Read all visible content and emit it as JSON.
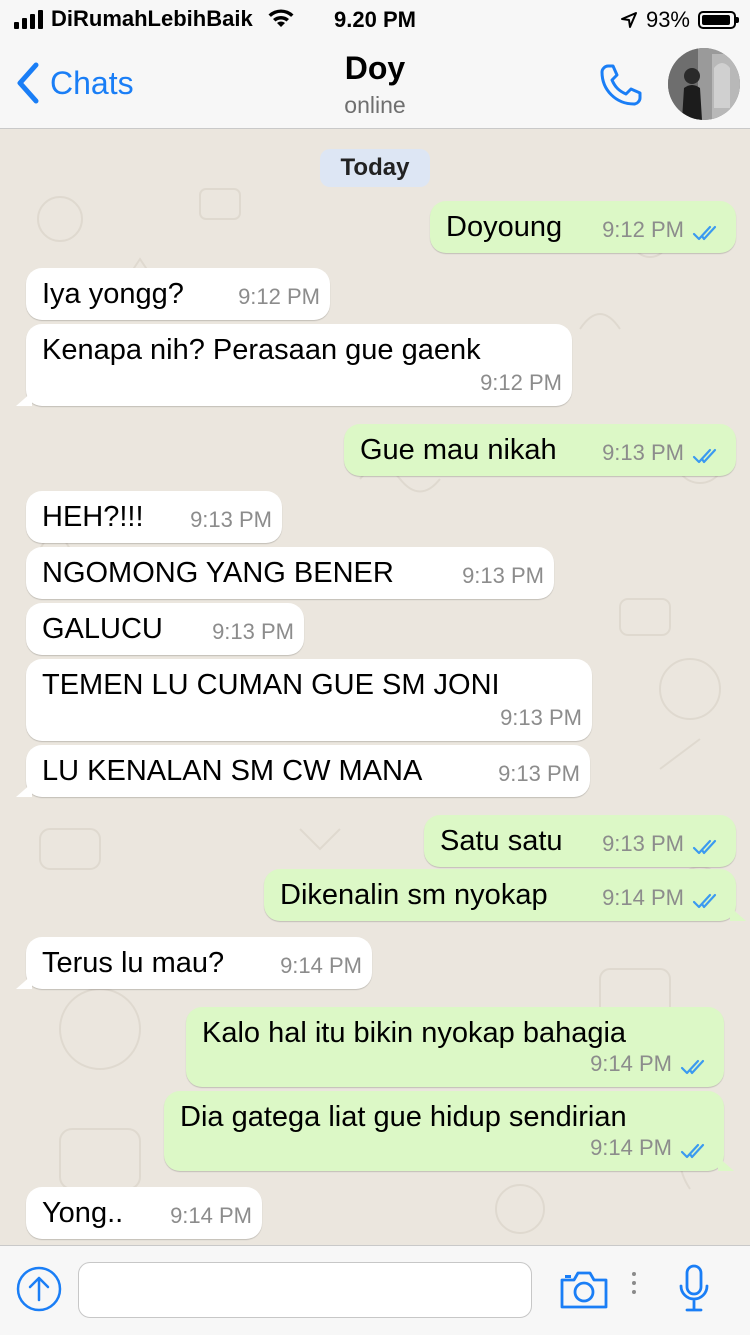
{
  "status_bar": {
    "carrier": "DiRumahLebihBaik",
    "time": "9.20 PM",
    "battery": "93%",
    "battery_level": 0.93
  },
  "header": {
    "back_label": "Chats",
    "contact_name": "Doy",
    "status": "online"
  },
  "chat": {
    "day_label": "Today",
    "messages": [
      {
        "dir": "out",
        "text": "Doyoung",
        "time": "9:12 PM"
      },
      {
        "dir": "in",
        "text": "Iya yongg?",
        "time": "9:12 PM"
      },
      {
        "dir": "in",
        "text": "Kenapa nih? Perasaan gue gaenk",
        "time": "9:12 PM"
      },
      {
        "dir": "out",
        "text": "Gue mau nikah",
        "time": "9:13 PM"
      },
      {
        "dir": "in",
        "text": "HEH?!!!",
        "time": "9:13 PM"
      },
      {
        "dir": "in",
        "text": "NGOMONG YANG BENER",
        "time": "9:13 PM"
      },
      {
        "dir": "in",
        "text": "GALUCU",
        "time": "9:13 PM"
      },
      {
        "dir": "in",
        "text": "TEMEN LU CUMAN GUE SM JONI",
        "time": "9:13 PM"
      },
      {
        "dir": "in",
        "text": "LU KENALAN SM CW MANA",
        "time": "9:13 PM"
      },
      {
        "dir": "out",
        "text": "Satu satu",
        "time": "9:13 PM"
      },
      {
        "dir": "out",
        "text": "Dikenalin sm nyokap",
        "time": "9:14 PM"
      },
      {
        "dir": "in",
        "text": "Terus lu mau?",
        "time": "9:14 PM"
      },
      {
        "dir": "out",
        "text": "Kalo hal itu bikin nyokap bahagia",
        "time": "9:14 PM"
      },
      {
        "dir": "out",
        "text": "Dia gatega liat gue hidup sendirian",
        "time": "9:14 PM"
      },
      {
        "dir": "in",
        "text": "Yong..",
        "time": "9:14 PM"
      }
    ]
  },
  "input": {
    "placeholder": ""
  },
  "icons": {
    "back": "chevron-left-icon",
    "call": "phone-icon",
    "attach": "plus-circle-icon",
    "camera": "camera-icon",
    "mic": "microphone-icon",
    "read_receipt": "double-check-icon"
  },
  "colors": {
    "accent": "#1a7ef6",
    "outgoing_bubble": "#dcf8c6",
    "incoming_bubble": "#ffffff",
    "read_tick": "#3b9af0"
  }
}
